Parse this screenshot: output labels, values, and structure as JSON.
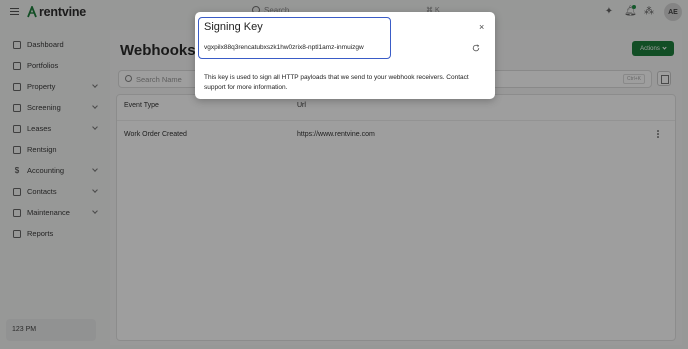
{
  "topbar": {
    "brand": "rentvine",
    "search_placeholder": "Search",
    "search_shortcut": "⌘ K",
    "user_initials": "AE"
  },
  "sidebar": {
    "items": [
      {
        "label": "Dashboard",
        "icon": "dashboard-icon",
        "has_chevron": false
      },
      {
        "label": "Portfolios",
        "icon": "folder-icon",
        "has_chevron": false
      },
      {
        "label": "Property",
        "icon": "building-icon",
        "has_chevron": true
      },
      {
        "label": "Screening",
        "icon": "screening-icon",
        "has_chevron": true
      },
      {
        "label": "Leases",
        "icon": "lease-icon",
        "has_chevron": true
      },
      {
        "label": "Rentsign",
        "icon": "signature-icon",
        "has_chevron": false
      },
      {
        "label": "Accounting",
        "icon": "dollar-icon",
        "has_chevron": true
      },
      {
        "label": "Contacts",
        "icon": "contacts-icon",
        "has_chevron": true
      },
      {
        "label": "Maintenance",
        "icon": "wrench-icon",
        "has_chevron": true
      },
      {
        "label": "Reports",
        "icon": "reports-icon",
        "has_chevron": false
      }
    ],
    "time": "123 PM"
  },
  "main": {
    "title": "Webhooks",
    "actions_label": "Actions",
    "search_placeholder": "Search Name",
    "search_shortcut": "Ctrl+K",
    "columns": [
      "Event Type",
      "Url"
    ],
    "rows": [
      {
        "event_type": "Work Order Created",
        "url": "https://www.rentvine.com"
      }
    ]
  },
  "modal": {
    "title": "Signing Key",
    "close_label": "×",
    "key": "vgxpilx88q3rencatubxszk1hw0zrix8-nptl1amz-inmuizgw",
    "description": "This key is used to sign all HTTP payloads that we send to your webhook receivers. Contact support for more information."
  },
  "colors": {
    "brand_green": "#1e7f3c",
    "focus_blue": "#3a5cc7"
  }
}
